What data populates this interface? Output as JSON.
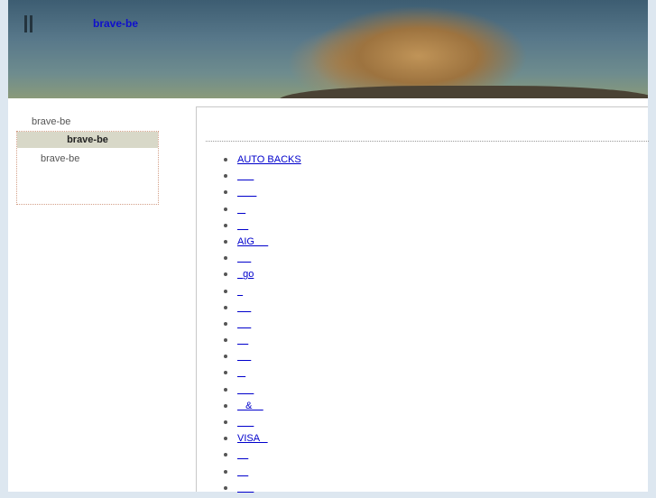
{
  "header": {
    "title": "brave-be",
    "logo_icon": "double-bar-icon",
    "banner_image": "hyrax-on-rock-photo"
  },
  "sidebar": {
    "caption": "brave-be",
    "box_title": "brave-be",
    "item": "brave-be"
  },
  "main": {
    "links": [
      "AUTO BACKS",
      "      ",
      "       ",
      "   ",
      "    ",
      "AIG     ",
      "     ",
      "  go",
      "  ",
      "     ",
      "     ",
      "    ",
      "     ",
      "   ",
      "      ",
      "   &    ",
      "      ",
      "VISA   ",
      "    ",
      "    ",
      "      "
    ]
  },
  "colors": {
    "link": "#0000cc",
    "title": "#1010cc",
    "page_background": "#dde7f0"
  }
}
